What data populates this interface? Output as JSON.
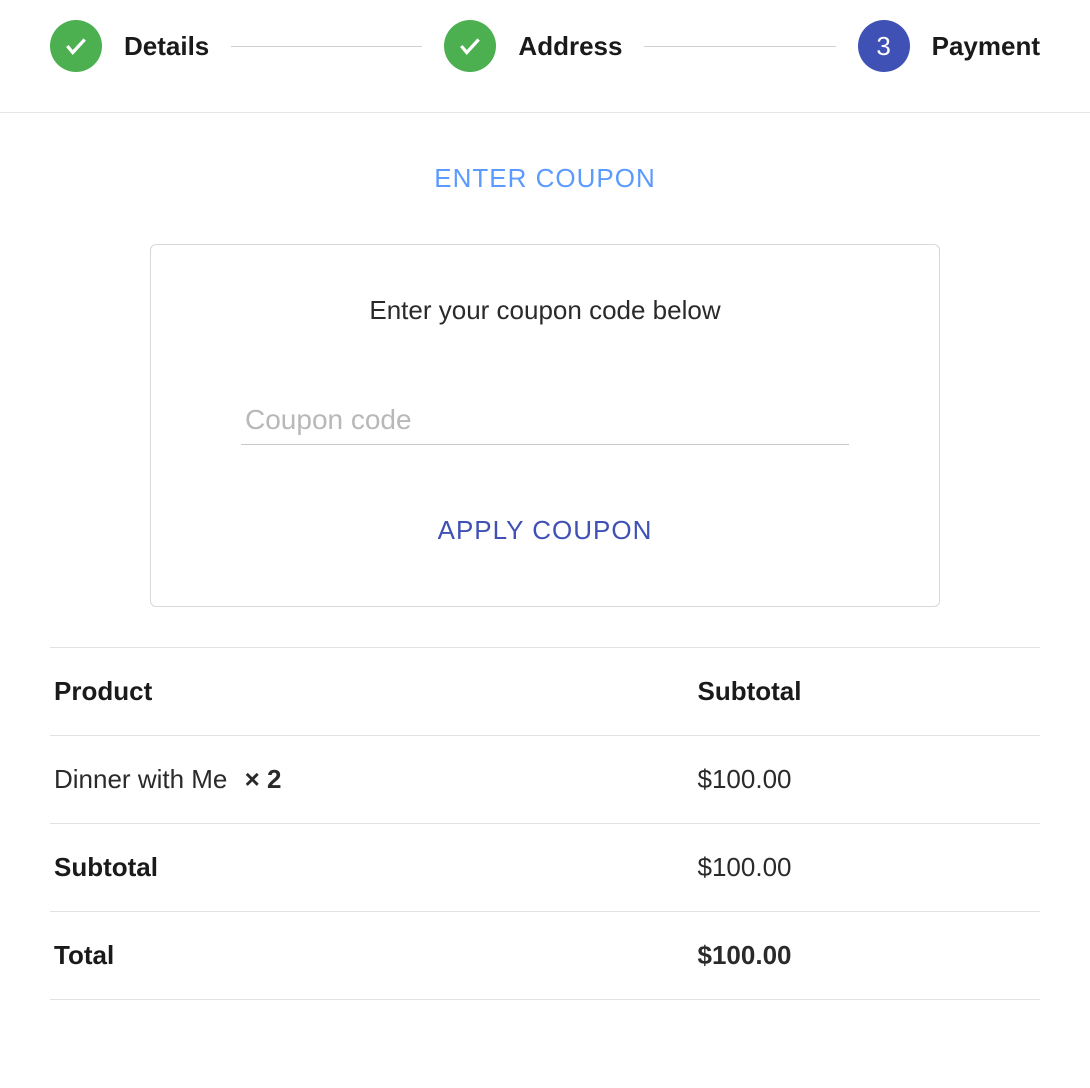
{
  "stepper": {
    "steps": [
      {
        "label": "Details",
        "state": "done"
      },
      {
        "label": "Address",
        "state": "done"
      },
      {
        "label": "Payment",
        "state": "active",
        "number": "3"
      }
    ]
  },
  "coupon": {
    "toggle_label": "ENTER COUPON",
    "prompt": "Enter your coupon code below",
    "placeholder": "Coupon code",
    "apply_label": "APPLY COUPON"
  },
  "order": {
    "headers": {
      "product": "Product",
      "subtotal": "Subtotal"
    },
    "line_item": {
      "name": "Dinner with Me",
      "qty": "× 2",
      "amount": "$100.00"
    },
    "subtotal": {
      "label": "Subtotal",
      "amount": "$100.00"
    },
    "total": {
      "label": "Total",
      "amount": "$100.00"
    }
  }
}
